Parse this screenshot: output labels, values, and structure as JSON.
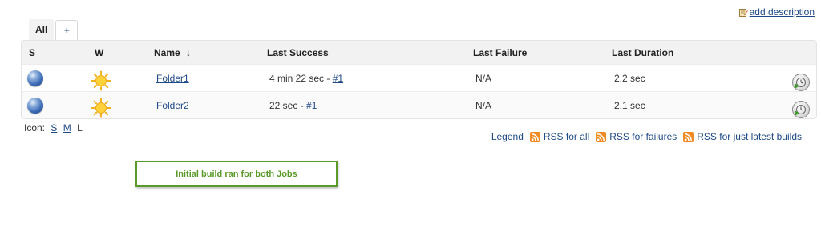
{
  "add_description": {
    "label": "add description",
    "icon": "notepad-pencil-icon"
  },
  "tabs": [
    {
      "label": "All",
      "active": true
    },
    {
      "label": "+",
      "active": false
    }
  ],
  "table": {
    "headers": {
      "status": "S",
      "weather": "W",
      "name": "Name",
      "sort_indicator": "↓",
      "last_success": "Last Success",
      "last_failure": "Last Failure",
      "last_duration": "Last Duration"
    },
    "rows": [
      {
        "status_icon": "blue-ball-icon",
        "weather_icon": "sunny-icon",
        "name": "Folder1",
        "last_success_time": "4 min 22 sec - ",
        "last_success_build": "#1",
        "last_failure": "N/A",
        "last_duration": "2.2 sec",
        "action_icon": "schedule-build-icon"
      },
      {
        "status_icon": "blue-ball-icon",
        "weather_icon": "sunny-icon",
        "name": "Folder2",
        "last_success_time": "22 sec - ",
        "last_success_build": "#1",
        "last_failure": "N/A",
        "last_duration": "2.1 sec",
        "action_icon": "schedule-build-icon"
      }
    ]
  },
  "icon_size": {
    "label": "Icon:",
    "options": [
      "S",
      "M",
      "L"
    ],
    "current": "L"
  },
  "footer_links": {
    "legend": "Legend",
    "rss_all": "RSS for all",
    "rss_failures": "RSS for failures",
    "rss_latest": "RSS for just latest builds"
  },
  "annotation": {
    "text": "Initial build ran for both Jobs"
  },
  "colors": {
    "link": "#204a87",
    "annotation_green": "#5a9a2a",
    "header_bg": "#f2f2f2",
    "rss_orange": "#f08a24"
  }
}
